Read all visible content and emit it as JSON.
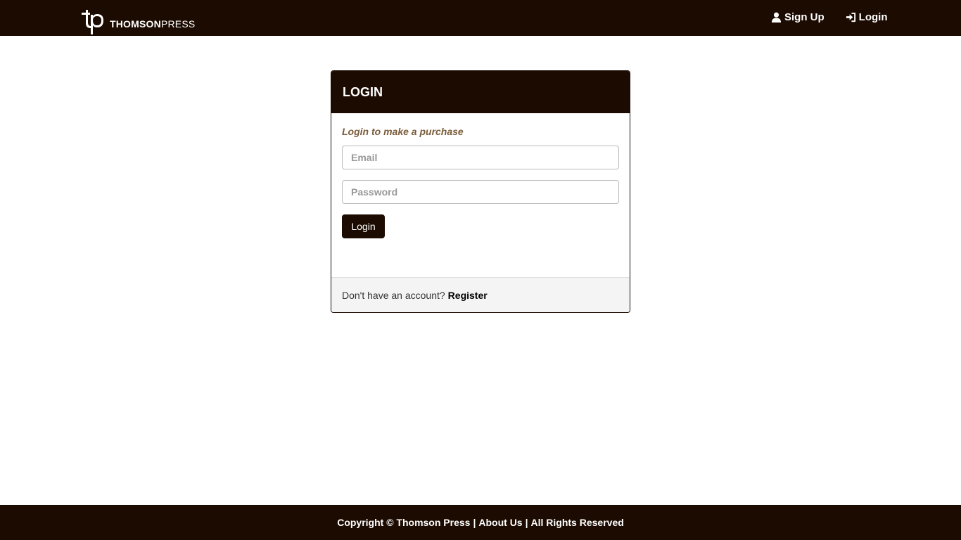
{
  "brand": {
    "logo_mark": "tp",
    "name_bold": "THOMSON",
    "name_regular": "PRESS"
  },
  "nav": {
    "signup": {
      "label": "Sign Up",
      "icon": "user-icon"
    },
    "login": {
      "label": "Login",
      "icon": "login-icon"
    }
  },
  "login_card": {
    "title": "LOGIN",
    "subtitle": "Login to make a purchase",
    "email_placeholder": "Email",
    "password_placeholder": "Password",
    "submit_label": "Login",
    "footer_text": "Don't have an account?",
    "register_label": "Register"
  },
  "footer": {
    "copyright": "Copyright © Thomson Press",
    "about": "About Us",
    "rights": "All Rights Reserved",
    "separator": "|"
  },
  "colors": {
    "primary": "#1c0b01",
    "subtitle": "#7a5c3a"
  }
}
